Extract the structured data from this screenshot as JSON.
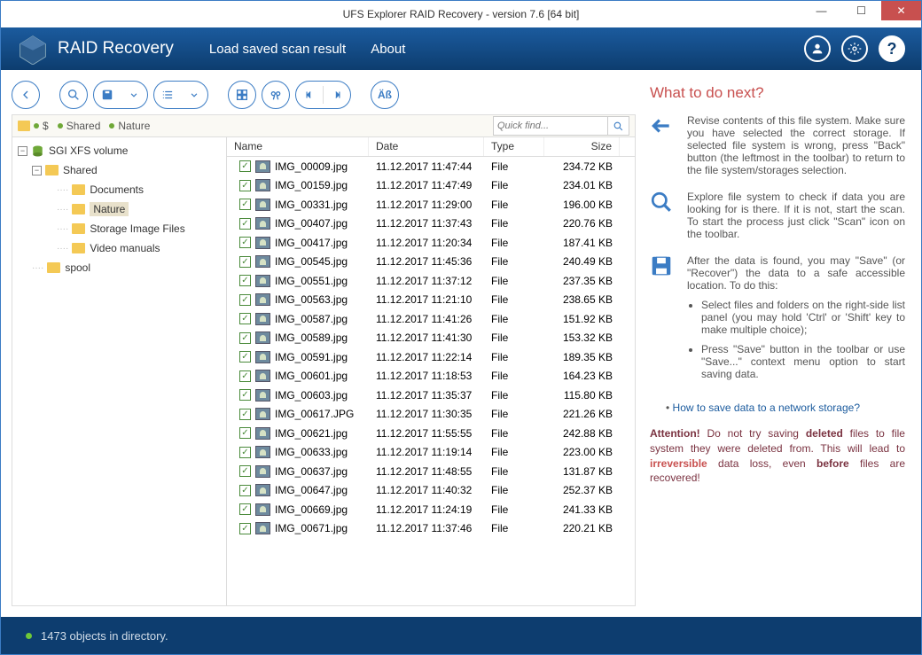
{
  "window": {
    "title": "UFS Explorer RAID Recovery - version 7.6 [64 bit]"
  },
  "brand": "RAID Recovery",
  "menu": {
    "load": "Load saved scan result",
    "about": "About"
  },
  "breadcrumb": {
    "root": "$",
    "shared": "Shared",
    "nature": "Nature"
  },
  "search": {
    "placeholder": "Quick find..."
  },
  "tree": {
    "root": "SGI XFS volume",
    "shared": "Shared",
    "documents": "Documents",
    "nature": "Nature",
    "sif": "Storage Image Files",
    "video": "Video manuals",
    "spool": "spool"
  },
  "cols": {
    "name": "Name",
    "date": "Date",
    "type": "Type",
    "size": "Size"
  },
  "files": [
    {
      "n": "IMG_00009.jpg",
      "d": "11.12.2017 11:47:44",
      "t": "File",
      "s": "234.72 KB"
    },
    {
      "n": "IMG_00159.jpg",
      "d": "11.12.2017 11:47:49",
      "t": "File",
      "s": "234.01 KB"
    },
    {
      "n": "IMG_00331.jpg",
      "d": "11.12.2017 11:29:00",
      "t": "File",
      "s": "196.00 KB"
    },
    {
      "n": "IMG_00407.jpg",
      "d": "11.12.2017 11:37:43",
      "t": "File",
      "s": "220.76 KB"
    },
    {
      "n": "IMG_00417.jpg",
      "d": "11.12.2017 11:20:34",
      "t": "File",
      "s": "187.41 KB"
    },
    {
      "n": "IMG_00545.jpg",
      "d": "11.12.2017 11:45:36",
      "t": "File",
      "s": "240.49 KB"
    },
    {
      "n": "IMG_00551.jpg",
      "d": "11.12.2017 11:37:12",
      "t": "File",
      "s": "237.35 KB"
    },
    {
      "n": "IMG_00563.jpg",
      "d": "11.12.2017 11:21:10",
      "t": "File",
      "s": "238.65 KB"
    },
    {
      "n": "IMG_00587.jpg",
      "d": "11.12.2017 11:41:26",
      "t": "File",
      "s": "151.92 KB"
    },
    {
      "n": "IMG_00589.jpg",
      "d": "11.12.2017 11:41:30",
      "t": "File",
      "s": "153.32 KB"
    },
    {
      "n": "IMG_00591.jpg",
      "d": "11.12.2017 11:22:14",
      "t": "File",
      "s": "189.35 KB"
    },
    {
      "n": "IMG_00601.jpg",
      "d": "11.12.2017 11:18:53",
      "t": "File",
      "s": "164.23 KB"
    },
    {
      "n": "IMG_00603.jpg",
      "d": "11.12.2017 11:35:37",
      "t": "File",
      "s": "115.80 KB"
    },
    {
      "n": "IMG_00617.JPG",
      "d": "11.12.2017 11:30:35",
      "t": "File",
      "s": "221.26 KB"
    },
    {
      "n": "IMG_00621.jpg",
      "d": "11.12.2017 11:55:55",
      "t": "File",
      "s": "242.88 KB"
    },
    {
      "n": "IMG_00633.jpg",
      "d": "11.12.2017 11:19:14",
      "t": "File",
      "s": "223.00 KB"
    },
    {
      "n": "IMG_00637.jpg",
      "d": "11.12.2017 11:48:55",
      "t": "File",
      "s": "131.87 KB"
    },
    {
      "n": "IMG_00647.jpg",
      "d": "11.12.2017 11:40:32",
      "t": "File",
      "s": "252.37 KB"
    },
    {
      "n": "IMG_00669.jpg",
      "d": "11.12.2017 11:24:19",
      "t": "File",
      "s": "241.33 KB"
    },
    {
      "n": "IMG_00671.jpg",
      "d": "11.12.2017 11:37:46",
      "t": "File",
      "s": "220.21 KB"
    }
  ],
  "help": {
    "title": "What to do next?",
    "p1": "Revise contents of this file system. Make sure you have selected the correct storage. If selected file system is wrong, press \"Back\" button (the leftmost in the toolbar) to return to the file system/storages selection.",
    "p2": "Explore file system to check if data you are looking for is there. If it is not, start the scan. To start the process just click \"Scan\" icon on the toolbar.",
    "p3": "After the data is found, you may \"Save\" (or \"Recover\") the data to a safe accessible location. To do this:",
    "li1": "Select files and folders on the right-side list panel (you may hold 'Ctrl' or 'Shift' key to make multiple choice);",
    "li2": "Press \"Save\" button in the toolbar or use \"Save...\" context menu option to start saving data.",
    "link": "How to save data to a network storage?",
    "attn_label": "Attention!",
    "attn1": " Do not try saving ",
    "attn_b1": "deleted",
    "attn2": " files to file system they were deleted from. This will lead to ",
    "attn_b2": "irreversible",
    "attn3": " data loss, even ",
    "attn_b3": "before",
    "attn4": " files are recovered!"
  },
  "status": "1473 objects in directory."
}
